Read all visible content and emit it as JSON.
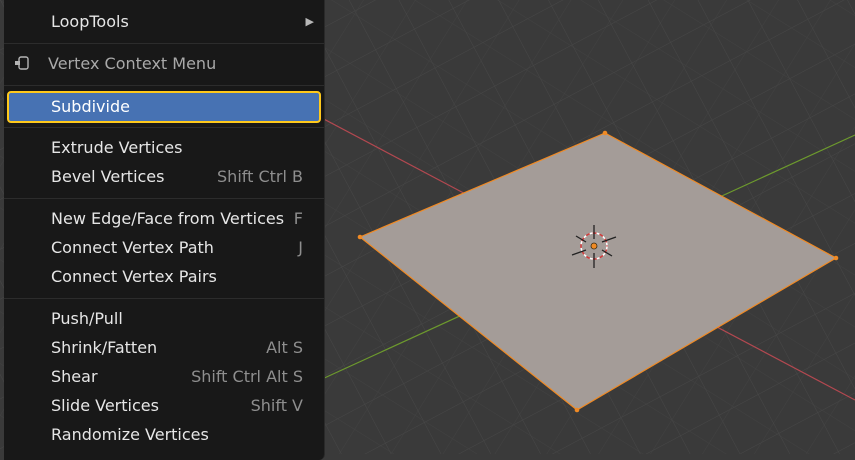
{
  "menu": {
    "header": {
      "label": "Vertex Context Menu",
      "icon": "pin-menu-icon"
    },
    "items": [
      {
        "id": "looptools",
        "label": "LoopTools",
        "shortcut": "",
        "submenu": true
      },
      {
        "id": "subdivide",
        "label": "Subdivide",
        "shortcut": "",
        "selected": true
      },
      {
        "id": "extrude",
        "label": "Extrude Vertices",
        "shortcut": ""
      },
      {
        "id": "bevel",
        "label": "Bevel Vertices",
        "shortcut": "Shift Ctrl B"
      },
      {
        "id": "new-edge-face",
        "label": "New Edge/Face from Vertices",
        "shortcut": "F"
      },
      {
        "id": "connect-path",
        "label": "Connect Vertex Path",
        "shortcut": "J"
      },
      {
        "id": "connect-pairs",
        "label": "Connect Vertex Pairs",
        "shortcut": ""
      },
      {
        "id": "push-pull",
        "label": "Push/Pull",
        "shortcut": ""
      },
      {
        "id": "shrink-fatten",
        "label": "Shrink/Fatten",
        "shortcut": "Alt S"
      },
      {
        "id": "shear",
        "label": "Shear",
        "shortcut": "Shift Ctrl Alt S"
      },
      {
        "id": "slide-vertices",
        "label": "Slide Vertices",
        "shortcut": "Shift V"
      },
      {
        "id": "randomize",
        "label": "Randomize Vertices",
        "shortcut": ""
      }
    ]
  },
  "colors": {
    "menu_bg": "#181818",
    "highlight": "#4772b3",
    "highlight_border": "#ffc91c",
    "viewport_bg": "#3a3a3a",
    "plane_fill": "#a49c98",
    "selection_outline": "#f08a24",
    "x_axis": "#b34850",
    "y_axis": "#6d9a2d"
  }
}
